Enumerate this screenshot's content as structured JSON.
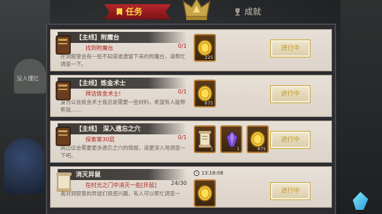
{
  "tabs": {
    "quest_label": "任务",
    "achievement_label": "成就"
  },
  "background": {
    "side_text": "没人懂忆"
  },
  "quests": [
    {
      "title": "【主线】附魔台",
      "target": "找到附魔台",
      "progress": "0/1",
      "description": "在洞窟里会有一些不知道谁遗留下来的附魔台，请帮忙调查一下。",
      "rewards": [
        {
          "type": "coin-icon",
          "count": "225"
        }
      ],
      "status": "进行中"
    },
    {
      "title": "【主线】炼金术士",
      "target": "拜访炼金术士!",
      "progress": "0/1",
      "description": "身为公会炼金术士我总是需要一些材料，希望有人能帮帮我……",
      "rewards": [
        {
          "type": "coin-icon",
          "count": "675"
        }
      ],
      "status": "进行中"
    },
    {
      "title": "【主线】 深入遗忘之穴",
      "target": "探索第30层",
      "progress": "0/1",
      "description": "高山议会需要更多遗忘之穴的情报，请更深入地调查一下吧。",
      "rewards": [
        {
          "type": "scroll-icon",
          "count": "1"
        },
        {
          "type": "gem-icon",
          "count": "1"
        },
        {
          "type": "coin-icon",
          "count": "675"
        }
      ],
      "status": "进行中"
    },
    {
      "title": "消灭异鼠",
      "target": "在时光之门中消灭一些[异鼠]",
      "progress": "24/30",
      "description": "我对洞窟里的异鼠们很感兴趣，有人可以帮忙调查一",
      "timer": "13:18:08",
      "rewards": [
        {
          "type": "coin-icon",
          "count": ""
        }
      ],
      "status": "进行中"
    }
  ],
  "colors": {
    "active_tab": "#b6262a",
    "status_gold": "#c0962a",
    "target_red": "#b0231d"
  }
}
